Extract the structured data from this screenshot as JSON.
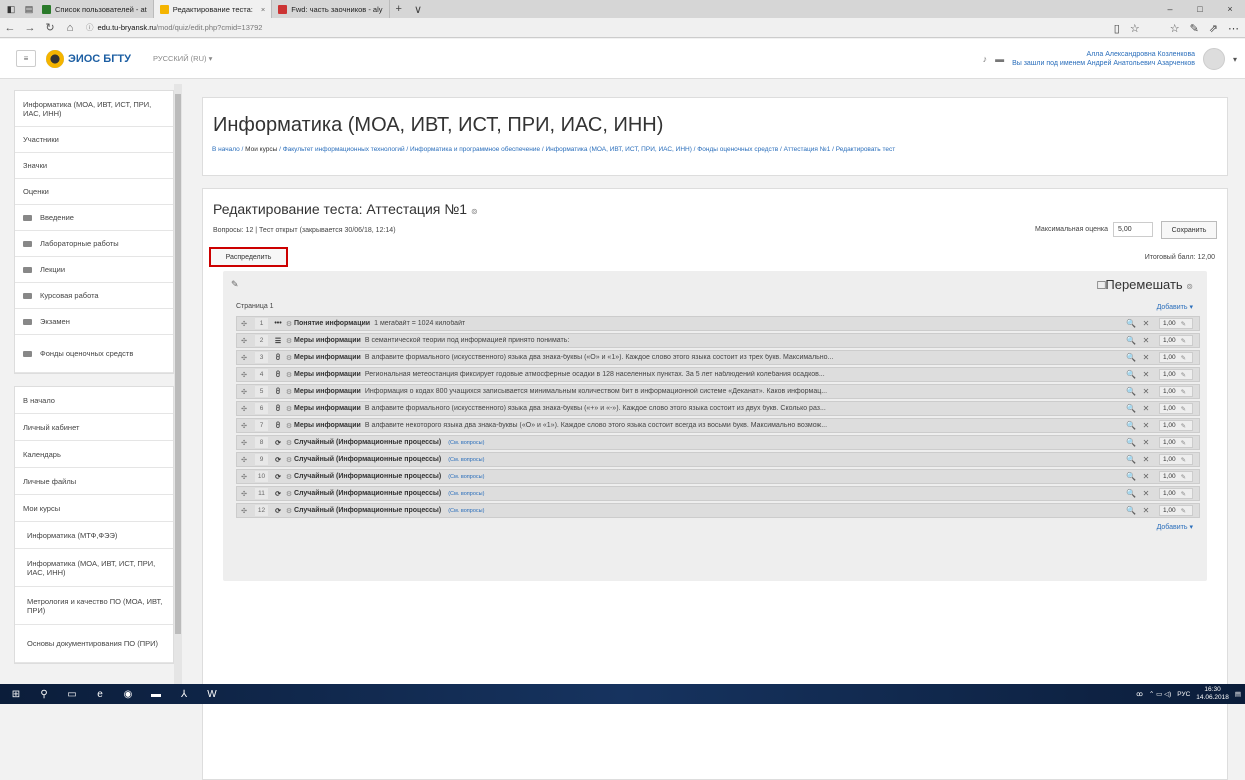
{
  "browser": {
    "tabs": [
      {
        "label": "Список пользователей - at",
        "icon_color": "#2a7a2a",
        "active": false
      },
      {
        "label": "Редактирование теста:",
        "icon_color": "#f4b400",
        "active": true
      },
      {
        "label": "Fwd: часть заочников - aly",
        "icon_color": "#c33",
        "active": false
      }
    ],
    "close_glyph": "×",
    "newtab_glyph": "+",
    "tabmenu_glyph": "∨",
    "win_min": "–",
    "win_max": "□",
    "win_close": "×",
    "nav": {
      "back": "←",
      "forward": "→",
      "reload": "↻",
      "home": "⌂"
    },
    "url_host": "edu.tu-bryansk.ru",
    "url_path": "/mod/quiz/edit.php?cmid=13792",
    "toolbar_icons": {
      "reader": "▯",
      "fav": "☆",
      "favs": "☆",
      "pen": "✎",
      "share": "⇗",
      "more": "⋯"
    }
  },
  "site": {
    "brand": "ЭИОС БГТУ",
    "language": "РУССКИЙ (RU) ▾",
    "burger": "≡",
    "user_name": "Алла Александровна Козленкова",
    "user_logged_as": "Вы зашли под именем Андрей Анатольевич Азарченков",
    "bell": "🔔",
    "chat": "▪",
    "caret": "▾"
  },
  "sidebar": {
    "block1": [
      {
        "label": "Информатика (МОА, ИВТ, ИСТ, ПРИ, ИАС, ИНН)",
        "folder": false,
        "h": 36
      },
      {
        "label": "Участники",
        "folder": false,
        "h": 26
      },
      {
        "label": "Значки",
        "folder": false,
        "h": 26
      },
      {
        "label": "Оценки",
        "folder": false,
        "h": 26
      },
      {
        "label": "Введение",
        "folder": true,
        "h": 26
      },
      {
        "label": "Лабораторные работы",
        "folder": true,
        "h": 26
      },
      {
        "label": "Лекции",
        "folder": true,
        "h": 26
      },
      {
        "label": "Курсовая работа",
        "folder": true,
        "h": 26
      },
      {
        "label": "Экзамен",
        "folder": true,
        "h": 26
      },
      {
        "label": "Фонды оценочных средств",
        "folder": true,
        "h": 38
      }
    ],
    "block2": [
      {
        "label": "В начало",
        "ind": false,
        "h": 27
      },
      {
        "label": "Личный кабинет",
        "ind": false,
        "h": 27
      },
      {
        "label": "Календарь",
        "ind": false,
        "h": 27
      },
      {
        "label": "Личные файлы",
        "ind": false,
        "h": 27
      },
      {
        "label": "Мои курсы",
        "ind": false,
        "h": 27
      },
      {
        "label": "Информатика (МТФ,ФЭЭ)",
        "ind": true,
        "h": 27
      },
      {
        "label": "Информатика (МОА, ИВТ, ИСТ, ПРИ, ИАС, ИНН)",
        "ind": true,
        "h": 38
      },
      {
        "label": "Метрология и качество ПО (МОА, ИВТ, ПРИ)",
        "ind": true,
        "h": 38
      },
      {
        "label": "Основы документирования ПО (ПРИ)",
        "ind": true,
        "h": 38
      }
    ]
  },
  "course": {
    "title": "Информатика (МОА, ИВТ, ИСТ, ПРИ, ИАС, ИНН)",
    "breadcrumb": [
      "В начало",
      "Мои курсы",
      "Факультет информационных технологий",
      "Информатика и программное обеспечение",
      "Информатика (МОА, ИВТ, ИСТ, ПРИ, ИАС, ИНН)",
      "Фонды оценочных средств",
      "Аттестация №1",
      "Редактировать тест"
    ],
    "sep": " / "
  },
  "quiz": {
    "heading": "Редактирование теста: Аттестация №1",
    "help_glyph": "⊚",
    "meta": "Вопросы: 12 | Тест открыт (закрывается 30/06/18, 12:14)",
    "max_grade_label": "Максимальная оценка",
    "max_grade_value": "5,00",
    "save_label": "Сохранить",
    "repaginate_label": "Распределить",
    "total_label": "Итоговый балл: 12,00",
    "shuffle_label": "□Перемешать",
    "page_label": "Страница 1",
    "add_label": "Добавить ▾",
    "see_questions": "(См. вопросы)",
    "move_glyph": "✣",
    "gear_glyph": "⚙",
    "preview_glyph": "🔍",
    "delete_glyph": "✕",
    "edit_glyph": "✎",
    "questions": [
      {
        "n": "1",
        "icon": "•••",
        "name": "Понятие информации",
        "text": "1 мегабайт = 1024 килобайт",
        "mark": "1,00",
        "random": false
      },
      {
        "n": "2",
        "icon": "☰",
        "name": "Меры информации",
        "text": "В семантической теории под информацией принято понимать:",
        "mark": "1,00",
        "random": false
      },
      {
        "n": "3",
        "icon": "⩉",
        "name": "Меры информации",
        "text": "В алфавите формального (искусственного) языка два знака-буквы («О» и «1»). Каждое слово этого языка состоит из трех букв. Максимально...",
        "mark": "1,00",
        "random": false
      },
      {
        "n": "4",
        "icon": "⩉",
        "name": "Меры информации",
        "text": "Региональная метеостанция фиксирует годовые атмосферные осадки в 128 населенных пунктах. За 5 лет наблюдений колебания осадков...",
        "mark": "1,00",
        "random": false
      },
      {
        "n": "5",
        "icon": "⩉",
        "name": "Меры информации",
        "text": "Информация о кодах 800 учащихся записывается минимальным количеством бит в информационной системе «Деканат». Каков информац...",
        "mark": "1,00",
        "random": false
      },
      {
        "n": "6",
        "icon": "⩉",
        "name": "Меры информации",
        "text": "В алфавите формального (искусственного) языка два знака-буквы («+» и «-»). Каждое слово этого языка состоит из двух букв. Сколько раз...",
        "mark": "1,00",
        "random": false
      },
      {
        "n": "7",
        "icon": "⩉",
        "name": "Меры информации",
        "text": "В алфавите некоторого языка два знака-буквы («О» и «1»). Каждое слово этого языка состоит всегда из восьми букв. Максимально возмож...",
        "mark": "1,00",
        "random": false
      },
      {
        "n": "8",
        "icon": "⟳",
        "name": "Случайный (Информационные процессы)",
        "text": "",
        "mark": "1,00",
        "random": true
      },
      {
        "n": "9",
        "icon": "⟳",
        "name": "Случайный (Информационные процессы)",
        "text": "",
        "mark": "1,00",
        "random": true
      },
      {
        "n": "10",
        "icon": "⟳",
        "name": "Случайный (Информационные процессы)",
        "text": "",
        "mark": "1,00",
        "random": true
      },
      {
        "n": "11",
        "icon": "⟳",
        "name": "Случайный (Информационные процессы)",
        "text": "",
        "mark": "1,00",
        "random": true
      },
      {
        "n": "12",
        "icon": "⟳",
        "name": "Случайный (Информационные процессы)",
        "text": "",
        "mark": "1,00",
        "random": true
      }
    ]
  },
  "taskbar": {
    "icons": [
      "⊞",
      "⚲",
      "▭",
      "e",
      "◉",
      "▬",
      "⅄",
      "W"
    ],
    "lang": "РУС",
    "time": "16:30",
    "date": "14.06.2018",
    "tray": "⌃ ▭ ◁)"
  }
}
